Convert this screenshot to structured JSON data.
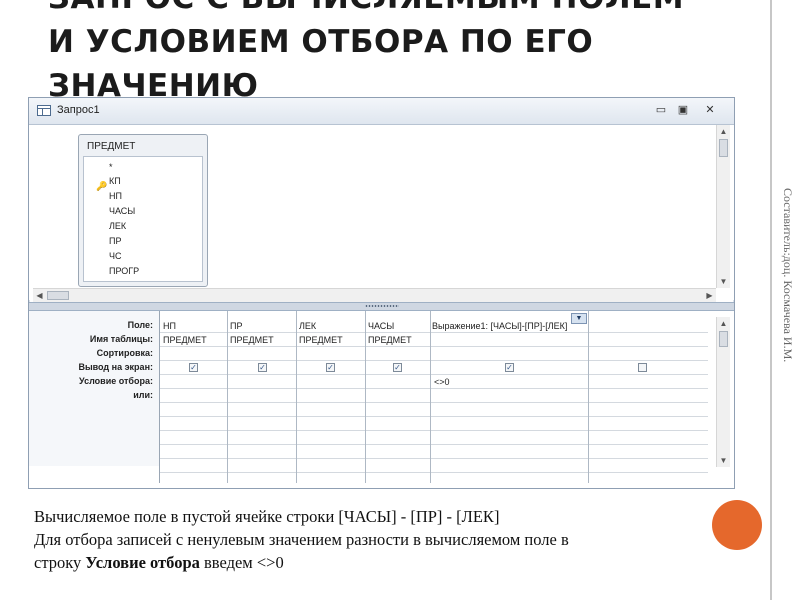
{
  "slide": {
    "title_line1": "ЗАПРОС С ВЫЧИСЛЯЕМЫМ ПОЛЕМ",
    "title_line2": "И УСЛОВИЕМ ОТБОРА ПО ЕГО",
    "title_line3": "ЗНАЧЕНИЮ",
    "side_credit": "Составитель:доц. Космачева И.М.",
    "accent_color": "#e5682c"
  },
  "window": {
    "title": "Запрос1",
    "minimize_glyph": "▭",
    "restore_glyph": "▣",
    "close_glyph": "✕"
  },
  "field_list": {
    "table_name": "ПРЕДМЕТ",
    "fields": [
      "*",
      "КП",
      "НП",
      "ЧАСЫ",
      "ЛЕК",
      "ПР",
      "ЧС",
      "ПРОГР"
    ],
    "key_icon": "key-icon"
  },
  "qbe": {
    "row_labels": {
      "field": "Поле:",
      "table": "Имя таблицы:",
      "sort": "Сортировка:",
      "show": "Вывод на экран:",
      "criteria": "Условие отбора:",
      "or": "или:"
    },
    "columns": [
      {
        "field": "НП",
        "table": "ПРЕДМЕТ",
        "show": true,
        "criteria": ""
      },
      {
        "field": "ПР",
        "table": "ПРЕДМЕТ",
        "show": true,
        "criteria": ""
      },
      {
        "field": "ЛЕК",
        "table": "ПРЕДМЕТ",
        "show": true,
        "criteria": ""
      },
      {
        "field": "ЧАСЫ",
        "table": "ПРЕДМЕТ",
        "show": true,
        "criteria": ""
      },
      {
        "field": "Выражение1: [ЧАСЫ]-[ПР]-[ЛЕК]",
        "table": "",
        "show": true,
        "criteria": "<>0"
      },
      {
        "field": "",
        "table": "",
        "show": false,
        "criteria": ""
      }
    ]
  },
  "caption": {
    "line1": "Вычисляемое поле в пустой ячейке строки  [ЧАСЫ] - [ПР] - [ЛЕК]",
    "line2": "Для отбора записей с ненулевым значением разности в вычисляемом поле в",
    "line3_pre": "строку ",
    "line3_bold": "Условие отбора",
    "line3_post": " введем <>0"
  }
}
